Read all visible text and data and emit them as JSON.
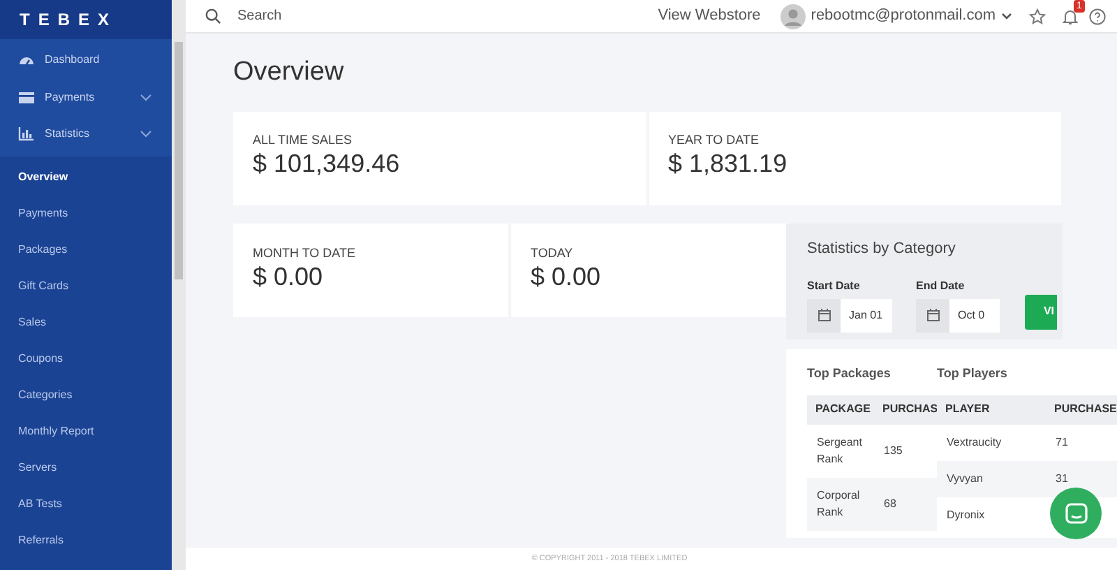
{
  "logo": "TEBEX",
  "sidebar": {
    "groups": [
      {
        "label": "Dashboard",
        "expandable": false
      },
      {
        "label": "Payments",
        "expandable": true
      },
      {
        "label": "Statistics",
        "expandable": true
      }
    ],
    "items": [
      {
        "label": "Overview",
        "selected": true
      },
      {
        "label": "Payments",
        "selected": false
      },
      {
        "label": "Packages",
        "selected": false
      },
      {
        "label": "Gift Cards",
        "selected": false
      },
      {
        "label": "Sales",
        "selected": false
      },
      {
        "label": "Coupons",
        "selected": false
      },
      {
        "label": "Categories",
        "selected": false
      },
      {
        "label": "Monthly Report",
        "selected": false
      },
      {
        "label": "Servers",
        "selected": false
      },
      {
        "label": "AB Tests",
        "selected": false
      },
      {
        "label": "Referrals",
        "selected": false
      }
    ]
  },
  "topbar": {
    "search": {
      "placeholder": "Search"
    },
    "view_webstore": "View Webstore",
    "user": "rebootmc@protonmail.com",
    "notification_badge": "1"
  },
  "page_title": "Overview",
  "stats_row_1": [
    {
      "label": "ALL TIME SALES",
      "value": "$ 101,349.46"
    },
    {
      "label": "YEAR TO DATE",
      "value": "$ 1,831.19"
    }
  ],
  "stats_row_2": [
    {
      "label": "MONTH TO DATE",
      "value": "$ 0.00"
    },
    {
      "label": "TODAY",
      "value": "$ 0.00"
    }
  ],
  "category_stats": {
    "title": "Statistics by Category",
    "start_date": {
      "label": "Start Date",
      "value": "Jan 01"
    },
    "end_date": {
      "label": "End Date",
      "value": "Oct 0"
    },
    "button": "VI"
  },
  "top_packages": {
    "title": "Top Packages",
    "columns": [
      "PACKAGE",
      "PURCHAS"
    ],
    "rows": [
      [
        "Sergeant Rank",
        "135"
      ],
      [
        "Corporal Rank",
        "68"
      ]
    ]
  },
  "top_players": {
    "title": "Top Players",
    "columns": [
      "PLAYER",
      "PURCHASE"
    ],
    "rows": [
      [
        "Vextraucity",
        "71"
      ],
      [
        "Vyvyan",
        "31"
      ],
      [
        "Dyronix"
      ]
    ]
  },
  "footer": "© COPYRIGHT 2011 - 2018 TEBEX LIMITED"
}
